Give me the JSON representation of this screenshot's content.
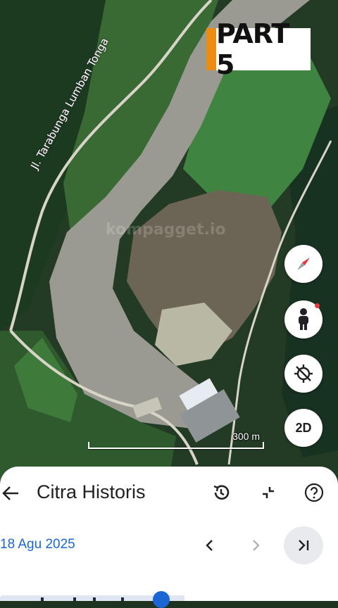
{
  "overlay": {
    "badge_text": "PART 5",
    "badge_accent": "#ec8c10"
  },
  "map": {
    "road_label": "Jl. Tarabunga Lumban Tonga",
    "watermark": "kompagget.io",
    "scale_label": "300 m"
  },
  "controls": {
    "compass": "compass-icon",
    "street_view": "pegman-icon",
    "location": "location-off-icon",
    "view_mode_label": "2D"
  },
  "panel": {
    "title": "Citra Historis",
    "date": "18 Agu 2025",
    "accent": "#1a66d2"
  }
}
